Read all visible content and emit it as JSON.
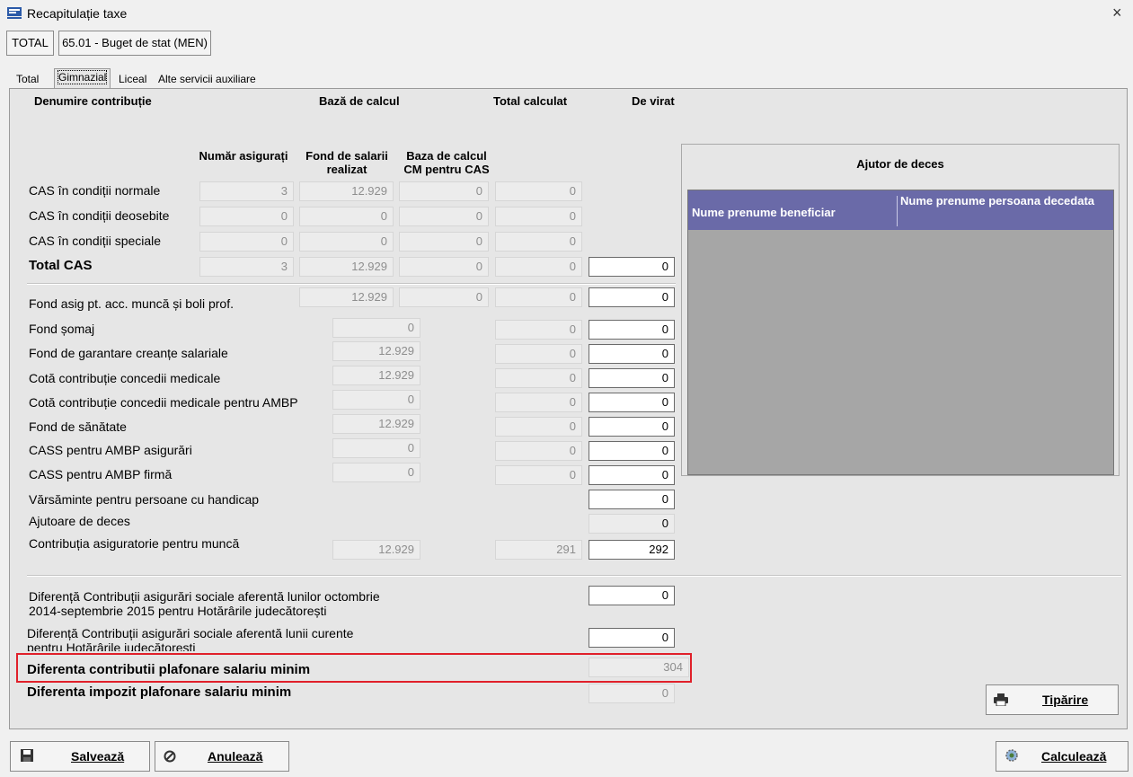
{
  "window": {
    "title": "Recapitulație taxe",
    "close": "×"
  },
  "toolbar": {
    "total": "TOTAL",
    "budget": "65.01 - Buget de stat (MEN)"
  },
  "tabs": [
    "Total",
    "Gimnazial",
    "Liceal",
    "Alte servicii auxiliare"
  ],
  "headers": {
    "denumire": "Denumire contribuție",
    "baza": "Bază de calcul",
    "total_calculat": "Total calculat",
    "de_virat": "De virat",
    "numar_asigurati": "Număr asigurați",
    "fond_salarii": "Fond de salarii realizat",
    "baza_cm": "Baza de calcul CM pentru CAS"
  },
  "cas_rows": [
    {
      "label": "CAS în condiții normale",
      "asigurati": "3",
      "fond": "12.929",
      "baza_cm": "0",
      "total": "0"
    },
    {
      "label": "CAS în condiții deosebite",
      "asigurati": "0",
      "fond": "0",
      "baza_cm": "0",
      "total": "0"
    },
    {
      "label": "CAS în condiții speciale",
      "asigurati": "0",
      "fond": "0",
      "baza_cm": "0",
      "total": "0"
    },
    {
      "label": "Total CAS",
      "asigurati": "3",
      "fond": "12.929",
      "baza_cm": "0",
      "total": "0",
      "virat": "0"
    }
  ],
  "fond_acc": {
    "label": "Fond asig pt. acc. muncă și boli prof.",
    "fond": "12.929",
    "baza_cm": "0",
    "total": "0",
    "virat": "0"
  },
  "rows": [
    {
      "label": "Fond șomaj",
      "baza": "0",
      "total": "0",
      "virat": "0"
    },
    {
      "label": "Fond de garantare creanțe salariale",
      "baza": "12.929",
      "total": "0",
      "virat": "0"
    },
    {
      "label": "Cotă contribuție concedii medicale",
      "baza": "12.929",
      "total": "0",
      "virat": "0"
    },
    {
      "label": "Cotă contribuție concedii medicale pentru AMBP",
      "baza": "0",
      "total": "0",
      "virat": "0"
    },
    {
      "label": "Fond de sănătate",
      "baza": "12.929",
      "total": "0",
      "virat": "0"
    },
    {
      "label": "CASS pentru AMBP asigurări",
      "baza": "0",
      "total": "0",
      "virat": "0"
    },
    {
      "label": "CASS pentru AMBP firmă",
      "baza": "0",
      "total": "0",
      "virat": "0"
    }
  ],
  "varsaminte": {
    "label": "Vărsăminte pentru persoane cu handicap",
    "virat": "0"
  },
  "ajutoare": {
    "label": "Ajutoare de deces",
    "virat": "0"
  },
  "cam": {
    "label": "Contribuția asiguratorie pentru muncă",
    "baza": "12.929",
    "total": "291",
    "virat": "292"
  },
  "diferente": {
    "oct": {
      "label1": "Diferență Contribuții asigurări sociale aferentă lunilor octombrie",
      "label2": "2014-septembrie 2015 pentru Hotărârile judecătorești",
      "value": "0"
    },
    "curent": {
      "label1": "Diferență Contribuții asigurări sociale aferentă lunii curente",
      "label2": "pentru Hotărârile judecătorești",
      "value": "0"
    },
    "plafonare_contrib": {
      "label": "Diferenta contributii plafonare salariu minim",
      "value": "304"
    },
    "plafonare_impozit": {
      "label": "Diferenta impozit plafonare salariu minim",
      "value": "0"
    }
  },
  "ajutor_deces": {
    "title": "Ajutor de deces",
    "columns": [
      "Nume prenume beneficiar",
      "Nume prenume persoana decedata"
    ]
  },
  "buttons": {
    "tiparire": "Tipărire",
    "salveaza": "Salvează",
    "anuleaza": "Anulează",
    "calculeaza": "Calculează"
  },
  "colors": {
    "grid_header": "#6a6aa8",
    "grid_body": "#a6a6a6",
    "highlight": "#e0202a"
  }
}
